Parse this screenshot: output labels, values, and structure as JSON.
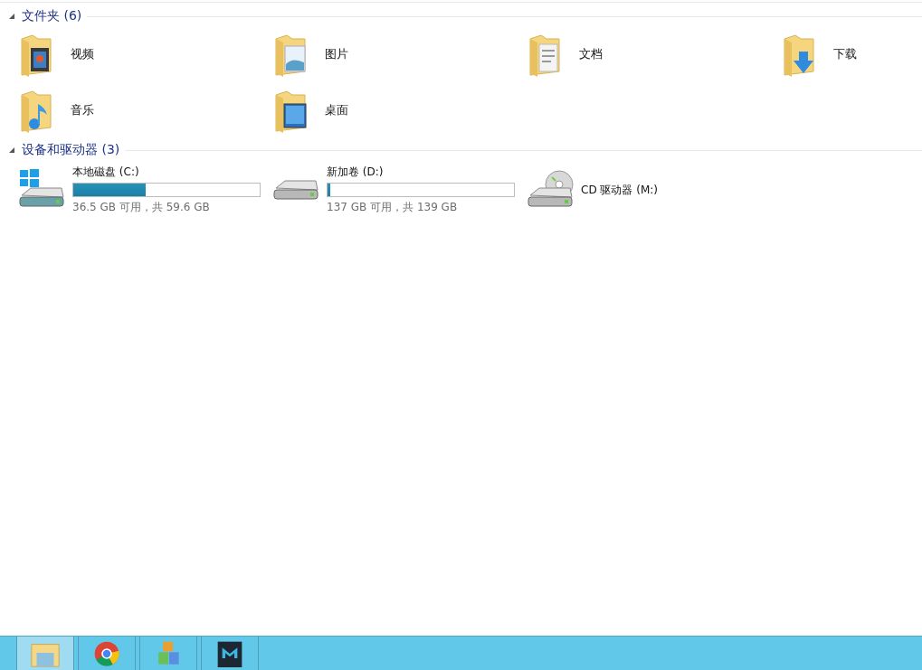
{
  "folders_group": {
    "title": "文件夹 (6)",
    "expanded": true,
    "items": [
      {
        "name": "视频",
        "kind": "video"
      },
      {
        "name": "图片",
        "kind": "pictures"
      },
      {
        "name": "文档",
        "kind": "documents"
      },
      {
        "name": "下载",
        "kind": "downloads"
      },
      {
        "name": "音乐",
        "kind": "music"
      },
      {
        "name": "桌面",
        "kind": "desktop"
      }
    ]
  },
  "drives_group": {
    "title": "设备和驱动器 (3)",
    "expanded": true,
    "items": [
      {
        "kind": "system_disk",
        "name": "本地磁盘 (C:)",
        "level": 0.39,
        "free_text": "36.5 GB 可用，共 59.6 GB"
      },
      {
        "kind": "disk",
        "name": "新加卷 (D:)",
        "level": 0.015,
        "free_text": "137 GB 可用，共 139 GB"
      },
      {
        "kind": "cd",
        "name": "CD 驱动器 (M:)"
      }
    ]
  },
  "taskbar": {
    "items": [
      {
        "kind": "explorer",
        "selected": true
      },
      {
        "kind": "browser",
        "selected": false
      },
      {
        "kind": "blocks",
        "selected": false
      },
      {
        "kind": "player",
        "selected": false
      }
    ]
  }
}
